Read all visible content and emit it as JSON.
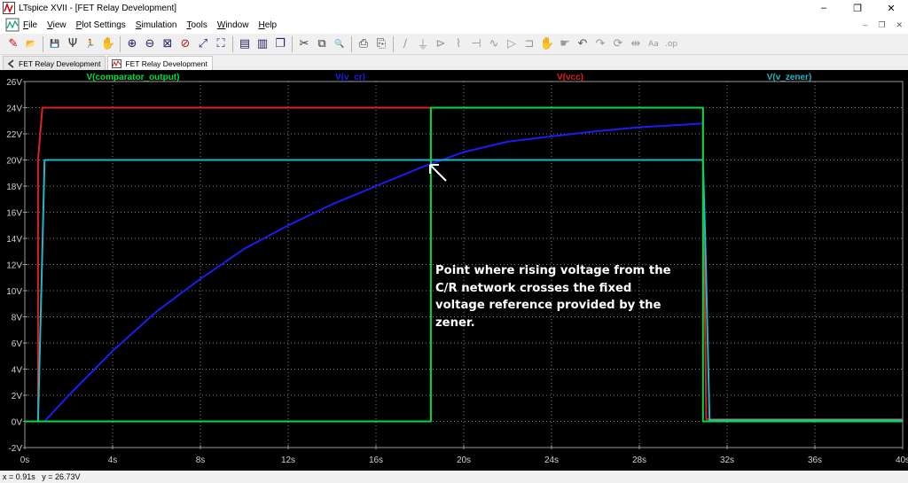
{
  "window": {
    "title": "LTspice XVII - [FET Relay Development]",
    "controls": [
      "–",
      "❐",
      "✕"
    ],
    "mdi_controls": [
      "–",
      "❐",
      "✕"
    ]
  },
  "menu": [
    "File",
    "View",
    "Plot Settings",
    "Simulation",
    "Tools",
    "Window",
    "Help"
  ],
  "toolbar": {
    "icons": [
      "control-panel-icon",
      "open-icon",
      "save-icon",
      "antenna-icon",
      "run-icon",
      "pan-hand-icon",
      "zoom-in-icon",
      "zoom-out-icon",
      "zoom-rect-icon",
      "zoom-cancel-icon",
      "autorange-icon",
      "fit-icon",
      "tile-vertical-icon",
      "tile-horizontal-icon",
      "cascade-icon",
      "cut-icon",
      "copy-icon",
      "find-icon",
      "print-icon",
      "print-setup-icon",
      "wire-icon",
      "ground-icon",
      "label-icon",
      "resistor-icon",
      "capacitor-icon",
      "inductor-icon",
      "diode-icon",
      "component-icon",
      "move-icon",
      "drag-icon",
      "undo-icon",
      "redo-icon",
      "rotate-icon",
      "mirror-icon",
      "text-icon",
      "spice-directive-icon"
    ]
  },
  "tabs": [
    {
      "label": "FET Relay Development",
      "icon": "schematic-icon",
      "active": false
    },
    {
      "label": "FET Relay Development",
      "icon": "waveform-icon",
      "active": true
    }
  ],
  "chart_data": {
    "type": "line",
    "xlabel": "",
    "ylabel": "",
    "xlim": [
      0,
      40
    ],
    "ylim": [
      -2,
      26
    ],
    "x_ticks": [
      "0s",
      "4s",
      "8s",
      "12s",
      "16s",
      "20s",
      "24s",
      "28s",
      "32s",
      "36s",
      "40s"
    ],
    "y_ticks": [
      "-2V",
      "0V",
      "2V",
      "4V",
      "6V",
      "8V",
      "10V",
      "12V",
      "14V",
      "16V",
      "18V",
      "20V",
      "22V",
      "24V",
      "26V"
    ],
    "grid": true,
    "legend_placement": "top",
    "background": "#000000",
    "grid_color": "#808080",
    "series": [
      {
        "name": "V(comparator_output)",
        "color": "#00dd44",
        "label_color": "#00dd44",
        "x": [
          0,
          18.5,
          18.5,
          30.9,
          30.9,
          40
        ],
        "y": [
          0,
          0,
          24,
          24,
          0,
          0
        ]
      },
      {
        "name": "V(v_cr)",
        "color": "#1c1cf0",
        "label_color": "#1c1cf0",
        "x": [
          0.9,
          2,
          4,
          6,
          8,
          10,
          12,
          14,
          16,
          18,
          20,
          22,
          24,
          26,
          28,
          30,
          30.9
        ],
        "y": [
          0,
          2,
          5.4,
          8.4,
          10.9,
          13.2,
          15,
          16.6,
          18,
          19.4,
          20.6,
          21.4,
          21.8,
          22.2,
          22.5,
          22.7,
          22.8
        ]
      },
      {
        "name": "V(vcc)",
        "color": "#e02020",
        "label_color": "#e02020",
        "x": [
          0,
          0.6,
          0.6,
          0.8,
          30.9,
          30.9,
          31.05,
          40
        ],
        "y": [
          0,
          0,
          20,
          24,
          24,
          20,
          0.15,
          0.15
        ]
      },
      {
        "name": "V(v_zener)",
        "color": "#20b8c8",
        "label_color": "#20b8c8",
        "x": [
          0,
          0.6,
          0.9,
          30.9,
          31.0,
          31.2,
          40
        ],
        "y": [
          0,
          0,
          20,
          20,
          14,
          0.1,
          0.1
        ]
      }
    ],
    "annotation": "Point where rising voltage from the C/R network crosses the fixed voltage reference provided by the zener."
  },
  "status": {
    "readout": "x = 0.91s   y = 26.73V"
  }
}
